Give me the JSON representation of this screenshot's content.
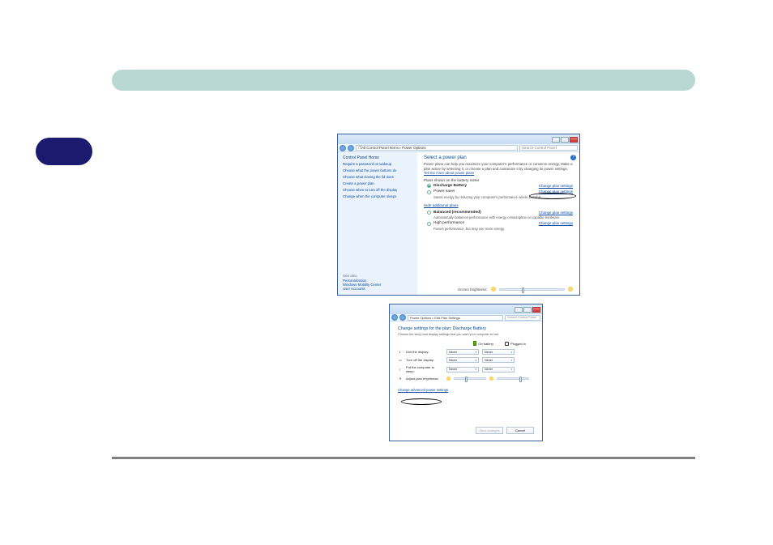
{
  "win1": {
    "breadcrumb": {
      "root": "All Control Panel Items",
      "leaf": "Power Options"
    },
    "search_placeholder": "Search Control Panel",
    "sidebar": {
      "home": "Control Panel Home",
      "links": [
        "Require a password on wakeup",
        "Choose what the power buttons do",
        "Choose what closing the lid does",
        "Create a power plan",
        "Choose when to turn off the display",
        "Change when the computer sleeps"
      ],
      "see_also_label": "See also",
      "see_also": [
        "Personalization",
        "Windows Mobility Center",
        "User Accounts"
      ]
    },
    "main": {
      "title": "Select a power plan",
      "desc_pre": "Power plans can help you maximize your computer's performance or conserve energy. Make a plan active by selecting it, or choose a plan and customize it by changing its power settings. ",
      "desc_link": "Tell me more about power plans",
      "shown_label": "Plans shown on the battery meter",
      "hide_label": "Hide additional plans",
      "change_link": "Change plan settings",
      "plans": [
        {
          "name": "Discharge Battery",
          "desc": ""
        },
        {
          "name": "Power saver",
          "desc": "Saves energy by reducing your computer's performance where possible."
        },
        {
          "name": "Balanced (recommended)",
          "desc": "Automatically balances performance with energy consumption on capable hardware."
        },
        {
          "name": "High performance",
          "desc": "Favors performance, but may use more energy."
        }
      ],
      "brightness_label": "Screen brightness:"
    }
  },
  "win2": {
    "breadcrumb": {
      "root": "Power Options",
      "leaf": "Edit Plan Settings"
    },
    "search_placeholder": "Search Control Panel",
    "title": "Change settings for the plan: Discharge Battery",
    "subtitle": "Choose the sleep and display settings that you want your computer to use.",
    "col_battery": "On battery",
    "col_plugged": "Plugged in",
    "rows": [
      {
        "label": "Dim the display:",
        "b": "Never",
        "p": "Never"
      },
      {
        "label": "Turn off the display:",
        "b": "Never",
        "p": "Never"
      },
      {
        "label": "Put the computer to sleep:",
        "b": "Never",
        "p": "Never"
      },
      {
        "label": "Adjust plan brightness:"
      }
    ],
    "advanced_link": "Change advanced power settings",
    "btn_save": "Save changes",
    "btn_cancel": "Cancel"
  }
}
